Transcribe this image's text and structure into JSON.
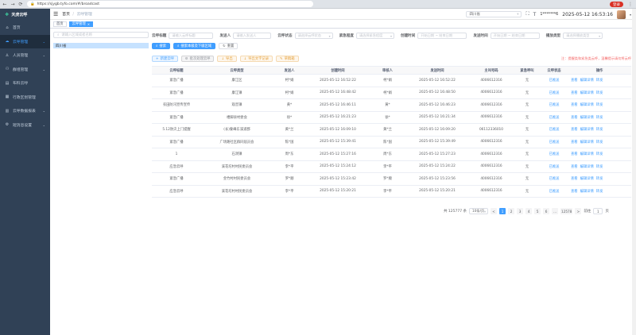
{
  "browser": {
    "url": "https://sjygb.tyfo.com/#/broadcast",
    "login_label": "登录"
  },
  "sidebar": {
    "brand": "天虎云呼",
    "items": [
      {
        "icon": "home-icon",
        "label": "首页",
        "expandable": false,
        "active": false
      },
      {
        "icon": "cloud-icon",
        "label": "云呼管理",
        "expandable": true,
        "active": true
      },
      {
        "icon": "user-icon",
        "label": "人员管理",
        "expandable": true,
        "active": false
      },
      {
        "icon": "group-icon",
        "label": "群组管理",
        "expandable": true,
        "active": false
      },
      {
        "icon": "template-icon",
        "label": "布料云呼",
        "expandable": false,
        "active": false
      },
      {
        "icon": "region-icon",
        "label": "行政区划管理",
        "expandable": false,
        "active": false
      },
      {
        "icon": "data-icon",
        "label": "云呼数据报表",
        "expandable": true,
        "active": false
      },
      {
        "icon": "settings-icon",
        "label": "短消息设置",
        "expandable": true,
        "active": false
      }
    ]
  },
  "topbar": {
    "breadcrumb": [
      "首页",
      "云呼管理"
    ],
    "department": "四川省",
    "phone": "1*******6",
    "datetime": "2025-05-12 16:53:16"
  },
  "tags": [
    {
      "label": "首页",
      "active": false
    },
    {
      "label": "云呼管理",
      "active": true
    }
  ],
  "tree": {
    "search_placeholder": "请输入区域或者名称",
    "node": "四川省"
  },
  "filters": {
    "row1": [
      {
        "label": "云呼标题",
        "placeholder": "请输入云呼标题",
        "width": 56,
        "dropdown": false
      },
      {
        "label": "发送人",
        "placeholder": "请输入发送人",
        "width": 48,
        "dropdown": false
      },
      {
        "label": "云呼状态",
        "placeholder": "请选择云呼状态",
        "width": 48,
        "dropdown": true
      },
      {
        "label": "紧急程度",
        "placeholder": "请选择紧急程度",
        "width": 48,
        "dropdown": true
      },
      {
        "label": "创建时间",
        "placeholder": "开始日期 ~ 结束日期",
        "width": 62,
        "dropdown": false
      },
      {
        "label": "发送时间",
        "placeholder": "开始日期 ~ 结束日期",
        "width": 62,
        "dropdown": false
      },
      {
        "label": "播放类型",
        "placeholder": "请选择播放类型",
        "width": 50,
        "dropdown": true
      }
    ],
    "search_button": "搜索",
    "search_sub_button": "搜索本级及下级区域",
    "reset_button": "重置"
  },
  "actions": {
    "buttons": [
      {
        "label": "新建云呼",
        "style": "pl",
        "icon": "+"
      },
      {
        "label": "批次处理云呼",
        "style": "info",
        "icon": "⚙"
      },
      {
        "label": "导出",
        "style": "warn",
        "icon": "↓"
      },
      {
        "label": "导出文字记录",
        "style": "warn",
        "icon": "↓"
      },
      {
        "label": "草稿箱",
        "style": "warn",
        "icon": "✎"
      }
    ],
    "notice": "注：提醒类和紧急类云呼，温馨提示请勿将云呼"
  },
  "table": {
    "columns": [
      "云呼标题",
      "云呼类型",
      "发送人",
      "创建时间",
      "审核人",
      "发送时间",
      "主叫号码",
      "紧急呼叫",
      "云呼状态",
      "操作"
    ],
    "rows": [
      [
        "紧急广播",
        "康江区",
        "柯*娟",
        "2025-05-12 16:52:22",
        "柯*娟",
        "2025-05-12 16:52:22",
        "4006612316",
        "无",
        "已推送",
        [
          "查看",
          "编辑详情",
          "转发"
        ]
      ],
      [
        "紧急广播",
        "康江镇",
        "柯*娟",
        "2025-05-12 16:48:42",
        "柯*娟",
        "2025-05-12 16:48:50",
        "4006612316",
        "无",
        "已推送",
        [
          "查看",
          "编辑详情",
          "转发"
        ]
      ],
      [
        "农田防汛宣传宣传",
        "观音镇",
        "黄*",
        "2025-05-12 16:46:11",
        "黄*",
        "2025-05-12 16:46:23",
        "4006612316",
        "无",
        "已推送",
        [
          "查看",
          "编辑详情",
          "转发"
        ]
      ],
      [
        "紧急广播",
        "楼脚县村委会",
        "徐*",
        "2025-05-12 16:21:23",
        "徐*",
        "2025-05-12 16:21:34",
        "4006612316",
        "无",
        "已推送",
        [
          "查看",
          "编辑详情",
          "转发"
        ]
      ],
      [
        "5.12防灾上门提醒",
        "(长)秦峰东溪道郡",
        "黄*兰",
        "2025-05-12 16:09:10",
        "黄*兰",
        "2025-05-12 16:09:20",
        "06112336010",
        "无",
        "已推送",
        [
          "查看",
          "编辑详情",
          "转发"
        ]
      ],
      [
        "紧急广播",
        "广场路社区群同居员会",
        "陈*国",
        "2025-05-12 15:39:41",
        "陈*国",
        "2025-05-12 15:39:49",
        "4006612316",
        "无",
        "已推送",
        [
          "查看",
          "编辑详情",
          "转发"
        ]
      ],
      [
        "1",
        "石洞镇",
        "周*东",
        "2025-05-12 15:27:16",
        "周*东",
        "2025-05-12 15:27:23",
        "4006612316",
        "无",
        "已推送",
        [
          "查看",
          "编辑详情",
          "转发"
        ]
      ],
      [
        "应急云呼",
        "溪花坨村村民委员会",
        "李*平",
        "2025-05-12 15:24:12",
        "李*平",
        "2025-05-12 15:24:22",
        "4006612316",
        "无",
        "已推送",
        [
          "查看",
          "编辑详情",
          "转发"
        ]
      ],
      [
        "紧急广播",
        "金竹村村民委员会",
        "罗*顺",
        "2025-05-12 15:23:42",
        "罗*顺",
        "2025-05-12 15:23:56",
        "4006612316",
        "无",
        "已推送",
        [
          "查看",
          "编辑详情",
          "转发"
        ]
      ],
      [
        "应急云呼",
        "溪花坨村村民委员会",
        "李*平",
        "2025-05-12 15:20:21",
        "李*平",
        "2025-05-12 15:20:21",
        "4006612316",
        "无",
        "已推送",
        [
          "查看",
          "编辑详情",
          "转发"
        ]
      ]
    ]
  },
  "pagination": {
    "total": "共 125777 条",
    "page_size": "10条/页",
    "prev": "<",
    "pages": [
      "1",
      "2",
      "3",
      "4",
      "5",
      "6",
      "…",
      "12578"
    ],
    "current": "1",
    "next": ">",
    "goto_label": "前往",
    "goto_value": "1",
    "page_unit": "页"
  },
  "colors": {
    "sidebar_bg": "#304156",
    "accent": "#409eff",
    "notice": "#f56c6c"
  }
}
